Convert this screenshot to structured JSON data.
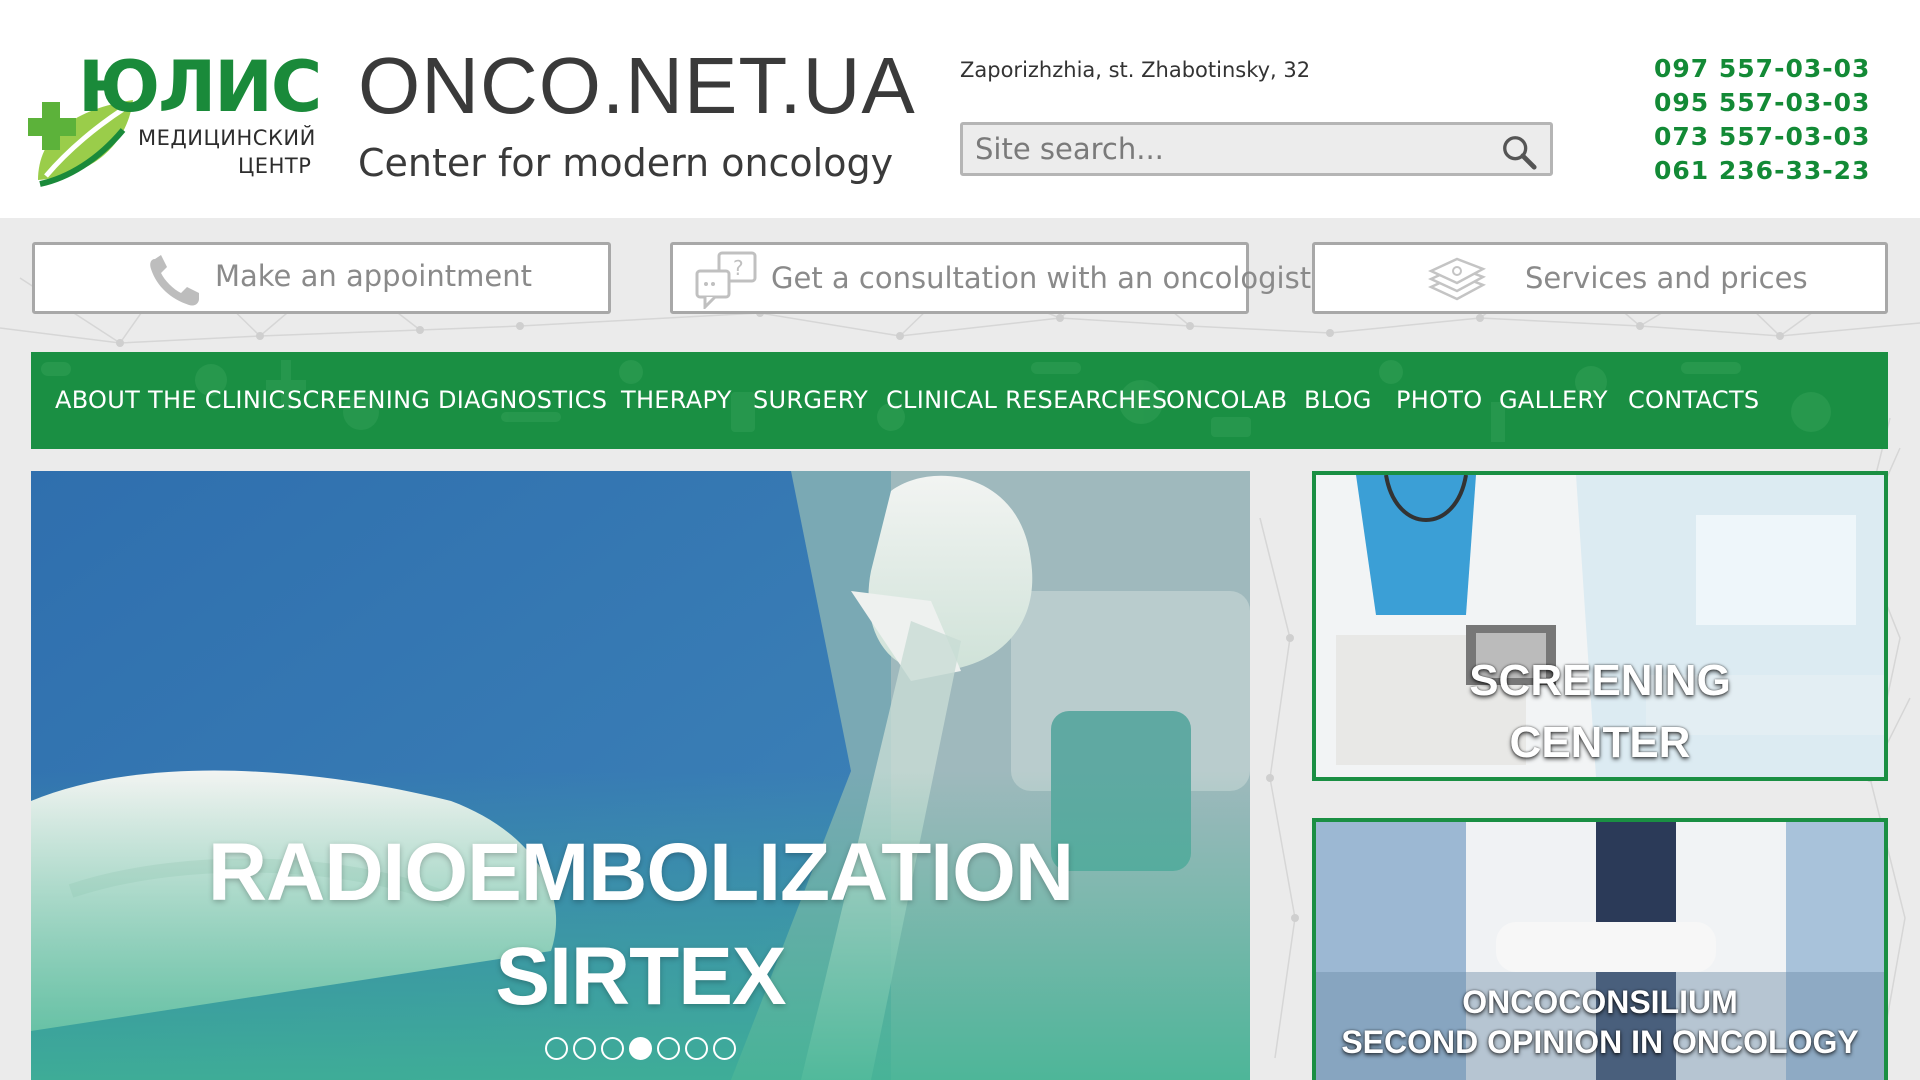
{
  "brand": {
    "logo_word": "ЮЛИС",
    "logo_sub1": "МЕДИЦИНСКИЙ",
    "logo_sub2": "ЦЕНТР",
    "site_title": "ONCO.NET.UA",
    "tagline": "Center for modern oncology",
    "accent_color": "#1a8f43"
  },
  "contact": {
    "address": "Zaporizhzhia, st. Zhabotinsky, 32",
    "phones": [
      "097 557-03-03",
      "095 557-03-03",
      "073 557-03-03",
      "061 236-33-23"
    ]
  },
  "search": {
    "placeholder": "Site search...",
    "icon": "search-icon"
  },
  "actions": [
    {
      "label": "Make an appointment",
      "icon": "phone-icon"
    },
    {
      "label": "Get a consultation with an oncologist",
      "icon": "chat-question-icon"
    },
    {
      "label": "Services and prices",
      "icon": "money-stack-icon"
    }
  ],
  "nav": {
    "items": [
      "ABOUT THE CLINIC",
      "SCREENING",
      "DIAGNOSTICS",
      "THERAPY",
      "SURGERY",
      "CLINICAL RESEARCHES",
      "ONCOLAB",
      "BLOG",
      "PHOTO",
      "GALLERY",
      "CONTACTS"
    ]
  },
  "hero": {
    "line1": "RADIOEMBOLIZATION",
    "line2": "SIRTEX",
    "slide_count": 7,
    "active_slide": 4
  },
  "cards": [
    {
      "line1": "SCREENING",
      "line2": "CENTER"
    },
    {
      "line1": "ONCOCONSILIUM",
      "line2": "SECOND OPINION IN ONCOLOGY"
    }
  ]
}
